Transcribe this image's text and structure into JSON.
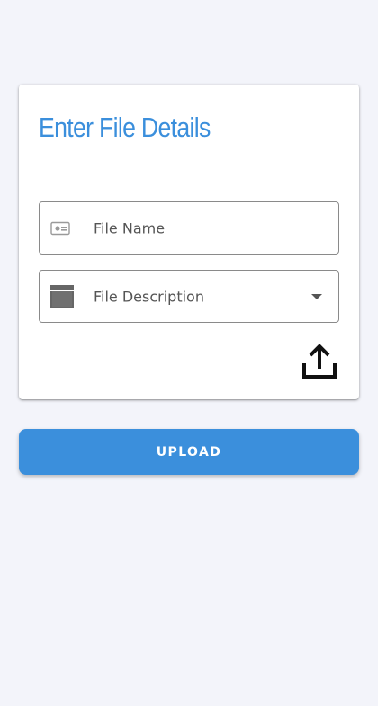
{
  "form": {
    "title": "Enter File Details",
    "file_name": {
      "placeholder": "File Name",
      "value": "",
      "icon": "badge-icon"
    },
    "file_description": {
      "placeholder": "File Description",
      "selected": "",
      "icon": "web-asset-icon",
      "dropdown_icon": "arrow-drop-down-icon"
    },
    "share_icon": "upload-share-icon"
  },
  "actions": {
    "upload_label": "UPLOAD"
  },
  "colors": {
    "accent": "#3b8fdc",
    "background": "#f3f4fa",
    "card": "#ffffff",
    "field_border": "#8a8a8a",
    "icon_gray": "#666666"
  }
}
